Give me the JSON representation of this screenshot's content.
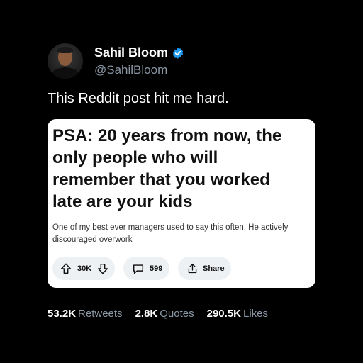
{
  "author": {
    "name": "Sahil Bloom",
    "handle": "@SahilBloom",
    "verified": true
  },
  "tweet": {
    "text": "This Reddit post hit me hard."
  },
  "reddit_card": {
    "title": "PSA: 20 years from now, the\nonly people who will\nremember that you worked\nlate are your kids",
    "body": "One of my best ever managers used to say this often. He actively\ndiscouraged overwork",
    "upvotes": "30K",
    "comments": "599",
    "share_label": "Share"
  },
  "stats": [
    {
      "value": "53.2K",
      "label": "Retweets"
    },
    {
      "value": "2.8K",
      "label": "Quotes"
    },
    {
      "value": "290.5K",
      "label": "Likes"
    }
  ],
  "colors": {
    "background": "#000000",
    "verified_blue": "#1d9bf0",
    "muted": "#8b98a5",
    "card_bg": "#ffffff",
    "pill_bg": "#eef1f3"
  },
  "icons": [
    "verified-badge-icon",
    "upvote-icon",
    "downvote-icon",
    "comment-icon",
    "share-icon"
  ]
}
